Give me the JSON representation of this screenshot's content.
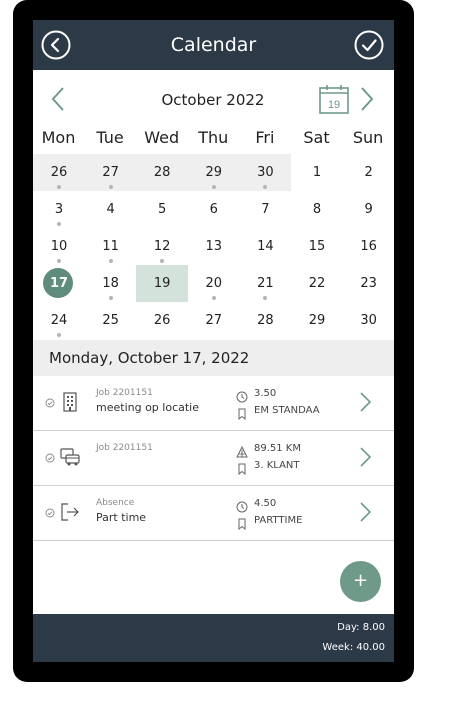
{
  "header": {
    "title": "Calendar"
  },
  "month_nav": {
    "label": "October 2022",
    "today_badge": "19"
  },
  "weekdays": [
    "Mon",
    "Tue",
    "Wed",
    "Thu",
    "Fri",
    "Sat",
    "Sun"
  ],
  "weeks": [
    [
      {
        "d": "26",
        "prev": true,
        "dot": true
      },
      {
        "d": "27",
        "prev": true,
        "dot": true
      },
      {
        "d": "28",
        "prev": true
      },
      {
        "d": "29",
        "prev": true,
        "dot": true
      },
      {
        "d": "30",
        "prev": true,
        "dot": true
      },
      {
        "d": "1"
      },
      {
        "d": "2"
      }
    ],
    [
      {
        "d": "3",
        "dot": true
      },
      {
        "d": "4"
      },
      {
        "d": "5"
      },
      {
        "d": "6"
      },
      {
        "d": "7"
      },
      {
        "d": "8"
      },
      {
        "d": "9"
      }
    ],
    [
      {
        "d": "10",
        "dot": true
      },
      {
        "d": "11",
        "dot": true
      },
      {
        "d": "12",
        "dot": true
      },
      {
        "d": "13"
      },
      {
        "d": "14"
      },
      {
        "d": "15"
      },
      {
        "d": "16"
      }
    ],
    [
      {
        "d": "17",
        "today": true
      },
      {
        "d": "18",
        "dot": true
      },
      {
        "d": "19",
        "selected": true
      },
      {
        "d": "20",
        "dot": true
      },
      {
        "d": "21",
        "dot": true
      },
      {
        "d": "22"
      },
      {
        "d": "23"
      }
    ],
    [
      {
        "d": "24",
        "dot": true
      },
      {
        "d": "25"
      },
      {
        "d": "26"
      },
      {
        "d": "27"
      },
      {
        "d": "28"
      },
      {
        "d": "29"
      },
      {
        "d": "30"
      }
    ]
  ],
  "day_header": "Monday, October 17, 2022",
  "entries": [
    {
      "icon": "building-icon",
      "small": "Job 2201151",
      "main": "meeting op locatie",
      "icon1": "clock-icon",
      "value1": "3.50",
      "icon2": "bookmark-icon",
      "value2": "EM STANDAA"
    },
    {
      "icon": "car-icon",
      "small": "Job 2201151",
      "main": "",
      "icon1": "distance-icon",
      "value1": "89.51 KM",
      "icon2": "bookmark-icon",
      "value2": "3. KLANT"
    },
    {
      "icon": "exit-icon",
      "small": "Absence",
      "main": "Part time",
      "icon1": "clock-icon",
      "value1": "4.50",
      "icon2": "bookmark-icon",
      "value2": "PARTTIME"
    }
  ],
  "fab": {
    "label": "+"
  },
  "footer": {
    "day": "Day: 8.00",
    "week": "Week: 40.00"
  },
  "colors": {
    "header_bg": "#2c3946",
    "accent": "#5f8c7c",
    "selected_bg": "#d3e2db",
    "prev_month_bg": "#efefef"
  }
}
